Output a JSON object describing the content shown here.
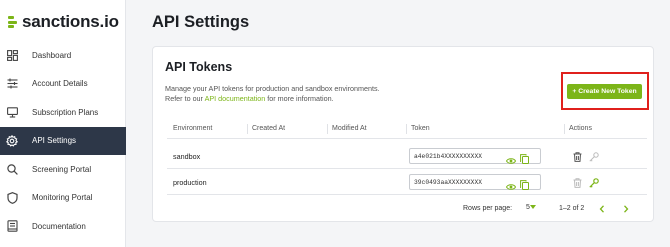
{
  "logo": {
    "text": "sanctions.io"
  },
  "sidebar": {
    "items": [
      {
        "label": "Dashboard",
        "icon": "dashboard-icon"
      },
      {
        "label": "Account Details",
        "icon": "sliders-icon"
      },
      {
        "label": "Subscription Plans",
        "icon": "monitor-icon"
      },
      {
        "label": "API Settings",
        "icon": "gear-icon",
        "active": true
      },
      {
        "label": "Screening Portal",
        "icon": "search-icon"
      },
      {
        "label": "Monitoring Portal",
        "icon": "shield-icon"
      },
      {
        "label": "Documentation",
        "icon": "book-icon"
      }
    ]
  },
  "page": {
    "title": "API Settings"
  },
  "tokens_card": {
    "title": "API Tokens",
    "description_line1": "Manage your API tokens for production and sandbox environments.",
    "description_prefix": "Refer to our ",
    "description_link": "API documentation",
    "description_suffix": " for more information.",
    "create_button": "+ Create New Token"
  },
  "table": {
    "headers": [
      "Environment",
      "Created At",
      "Modified At",
      "Token",
      "Actions"
    ],
    "rows": [
      {
        "environment": "sandbox",
        "token": "a4e021b4XXXXXXXXXX",
        "created_at": "",
        "modified_at": ""
      },
      {
        "environment": "production",
        "token": "39c0493aaXXXXXXXXX",
        "created_at": "",
        "modified_at": ""
      }
    ]
  },
  "pagination": {
    "rows_per_page_label": "Rows per page:",
    "rows_per_page": "5",
    "range": "1–2 of 2"
  },
  "colors": {
    "accent": "#7cb518",
    "active_nav": "#2d3748",
    "highlight_border": "#e0201c"
  }
}
